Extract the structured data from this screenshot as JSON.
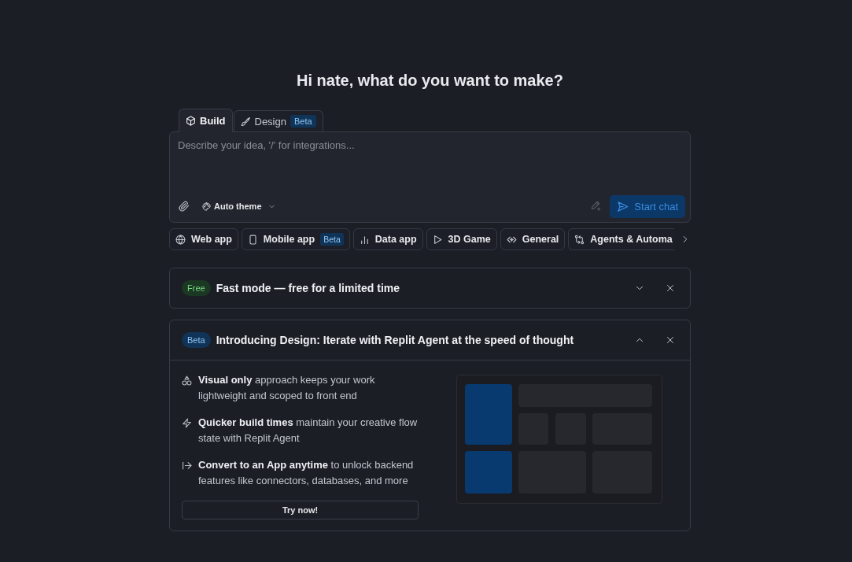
{
  "greeting": "Hi nate, what do you want to make?",
  "mode_tabs": [
    {
      "label": "Build",
      "selected": true
    },
    {
      "label": "Design",
      "badge": {
        "label": "Beta",
        "kind": "beta"
      },
      "selected": false
    }
  ],
  "prompt": {
    "placeholder": "Describe your idea, '/' for integrations...",
    "theme": "Auto theme",
    "enhance": {
      "disabled": true
    },
    "submit": {
      "label": "Start chat",
      "disabled": true
    }
  },
  "app_types": [
    {
      "label": "Web app"
    },
    {
      "label": "Mobile app",
      "badge": {
        "label": "Beta",
        "kind": "beta"
      }
    },
    {
      "label": "Data app"
    },
    {
      "label": "3D Game"
    },
    {
      "label": "General"
    },
    {
      "label": "Agents & Automa"
    }
  ],
  "cards": [
    {
      "badge": {
        "label": "Free",
        "kind": "free"
      },
      "title": "Fast mode — free for a limited time",
      "expanded": false
    },
    {
      "badge": {
        "label": "Beta",
        "kind": "beta"
      },
      "title": "Introducing Design: Iterate with Replit Agent at the speed of thought",
      "expanded": true,
      "features": [
        "**Visual only** approach keeps your work lightweight and scoped to front end",
        "**Quicker build times** maintain your creative flow state with Replit Agent",
        "**Convert to an App anytime** to unlock backend features like connectors, databases, and more"
      ],
      "action": "Try now!"
    }
  ]
}
